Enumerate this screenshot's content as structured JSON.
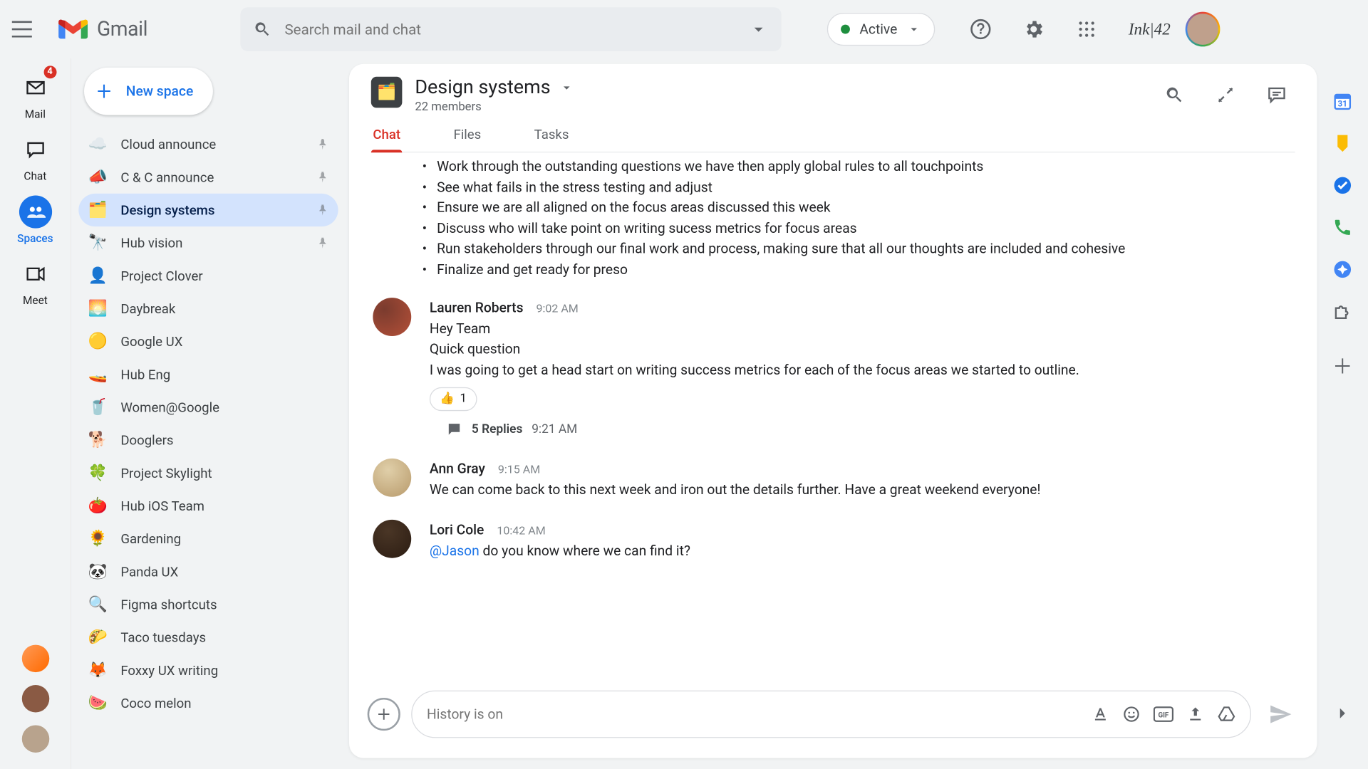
{
  "app": {
    "name": "Gmail"
  },
  "search": {
    "placeholder": "Search mail and chat"
  },
  "status": {
    "label": "Active"
  },
  "brand_label": "Ink|42",
  "rail": {
    "items": [
      {
        "label": "Mail",
        "badge": "4"
      },
      {
        "label": "Chat",
        "badge": ""
      },
      {
        "label": "Spaces",
        "badge": ""
      },
      {
        "label": "Meet",
        "badge": ""
      }
    ]
  },
  "sidebar": {
    "new_space_label": "New space",
    "spaces": [
      {
        "name": "Cloud announce",
        "emoji": "☁️",
        "pinned": true,
        "selected": false
      },
      {
        "name": "C & C announce",
        "emoji": "📣",
        "pinned": true,
        "selected": false
      },
      {
        "name": "Design systems",
        "emoji": "🗂️",
        "pinned": true,
        "selected": true
      },
      {
        "name": "Hub vision",
        "emoji": "🔭",
        "pinned": true,
        "selected": false
      },
      {
        "name": "Project Clover",
        "emoji": "👤",
        "pinned": false,
        "selected": false
      },
      {
        "name": "Daybreak",
        "emoji": "🌅",
        "pinned": false,
        "selected": false
      },
      {
        "name": "Google UX",
        "emoji": "🟡",
        "pinned": false,
        "selected": false
      },
      {
        "name": "Hub Eng",
        "emoji": "🚤",
        "pinned": false,
        "selected": false
      },
      {
        "name": "Women@Google",
        "emoji": "🥤",
        "pinned": false,
        "selected": false
      },
      {
        "name": "Dooglers",
        "emoji": "🐕",
        "pinned": false,
        "selected": false
      },
      {
        "name": "Project Skylight",
        "emoji": "🍀",
        "pinned": false,
        "selected": false
      },
      {
        "name": "Hub iOS Team",
        "emoji": "🍅",
        "pinned": false,
        "selected": false
      },
      {
        "name": "Gardening",
        "emoji": "🌻",
        "pinned": false,
        "selected": false
      },
      {
        "name": "Panda UX",
        "emoji": "🐼",
        "pinned": false,
        "selected": false
      },
      {
        "name": "Figma shortcuts",
        "emoji": "🔍",
        "pinned": false,
        "selected": false
      },
      {
        "name": "Taco tuesdays",
        "emoji": "🌮",
        "pinned": false,
        "selected": false
      },
      {
        "name": "Foxxy UX writing",
        "emoji": "🦊",
        "pinned": false,
        "selected": false
      },
      {
        "name": "Coco melon",
        "emoji": "🍉",
        "pinned": false,
        "selected": false
      }
    ]
  },
  "space": {
    "title": "Design systems",
    "members": "22 members",
    "emoji": "🗂️"
  },
  "tabs": [
    {
      "label": "Chat",
      "active": true
    },
    {
      "label": "Files",
      "active": false
    },
    {
      "label": "Tasks",
      "active": false
    }
  ],
  "bullets": [
    "Work through the outstanding questions we have then apply global rules to all touchpoints",
    "See what fails in the stress testing and adjust",
    "Ensure we are all aligned on the focus areas discussed this week",
    "Discuss who will take point on writing sucess metrics for focus areas",
    "Run stakeholders through our final work and process, making sure that all our thoughts are included and cohesive",
    "Finalize and get ready for preso"
  ],
  "messages": [
    {
      "author": "Lauren Roberts",
      "time": "9:02 AM",
      "lines": [
        "Hey Team",
        "Quick question",
        "I was going to get a head start on writing success metrics for each of the focus areas we started to outline."
      ],
      "reaction": {
        "emoji": "👍",
        "count": "1"
      },
      "replies": {
        "label": "5 Replies",
        "time": "9:21 AM"
      }
    },
    {
      "author": "Ann Gray",
      "time": "9:15 AM",
      "lines": [
        "We can come back to this next week and iron out the details further. Have a great weekend everyone!"
      ]
    },
    {
      "author": "Lori Cole",
      "time": "10:42 AM",
      "mention": "@Jason",
      "rest": " do you know where we can find it?"
    }
  ],
  "composer": {
    "placeholder": "History is on"
  }
}
